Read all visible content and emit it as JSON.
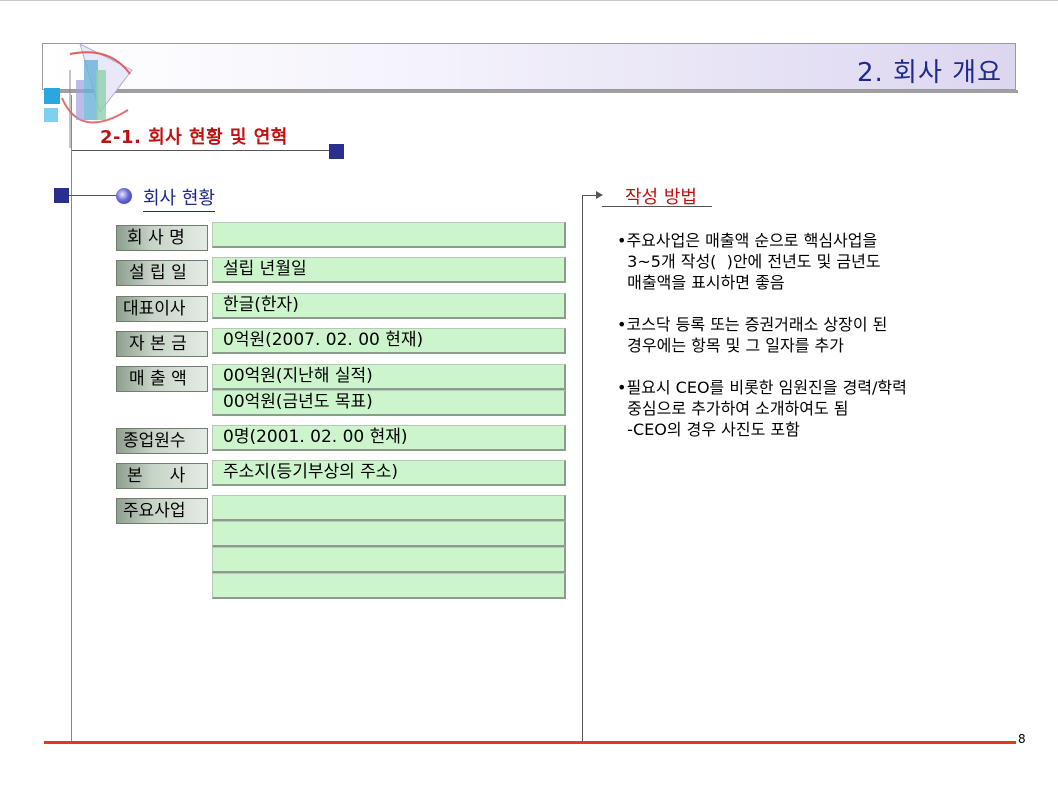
{
  "header": {
    "title": "2. 회사 개요"
  },
  "section": {
    "title": "2-1. 회사 현황 및 연혁"
  },
  "company_status": {
    "title": "회사 현황",
    "rows": [
      {
        "label": "회 사 명",
        "values": [
          ""
        ]
      },
      {
        "label": "설 립 일",
        "values": [
          "설립 년월일"
        ]
      },
      {
        "label": "대표이사",
        "values": [
          "한글(한자)"
        ]
      },
      {
        "label": "자 본 금",
        "values": [
          "0억원(2007. 02. 00 현재)"
        ]
      },
      {
        "label": "매 출 액",
        "values": [
          "00억원(지난해 실적)",
          "00억원(금년도 목표)"
        ]
      },
      {
        "label": "종업원수",
        "values": [
          "0명(2001. 02. 00 현재)"
        ]
      },
      {
        "label": "본     사",
        "values": [
          "주소지(등기부상의 주소)"
        ]
      },
      {
        "label": "주요사업",
        "values": [
          "",
          "",
          "",
          ""
        ]
      }
    ]
  },
  "guide": {
    "title": "작성 방법",
    "notes": [
      "•주요사업은 매출액 순으로 핵심사업을\n  3~5개 작성(  )안에 전년도 및 금년도\n  매출액을 표시하면 좋음",
      "•코스닥 등록 또는 증권거래소 상장이 된\n  경우에는 항목 및 그 일자를 추가",
      "•필요시 CEO를 비롯한 임원진을 경력/학력\n  중심으로 추가하여 소개하여도 됨\n  -CEO의 경우 사진도 포함"
    ]
  },
  "footer": {
    "page_number": "8"
  },
  "colors": {
    "accent_red": "#c01010",
    "navy": "#2a2f8f",
    "cell_green": "#ccf5cc",
    "footer_line": "#e03c14"
  }
}
